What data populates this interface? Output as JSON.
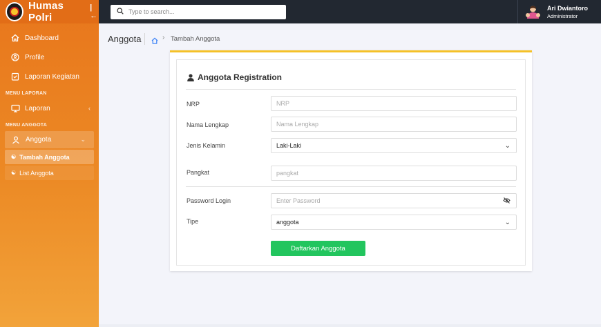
{
  "brand": {
    "name": "Humas Polri"
  },
  "sidebar": {
    "items": [
      {
        "label": "Dashboard"
      },
      {
        "label": "Profile"
      },
      {
        "label": "Laporan Kegiatan"
      }
    ],
    "sections": [
      {
        "label": "MENU LAPORAN",
        "items": [
          {
            "label": "Laporan"
          }
        ]
      },
      {
        "label": "MENU ANGGOTA",
        "items": [
          {
            "label": "Anggota"
          }
        ],
        "subitems": [
          {
            "label": "Tambah Anggota"
          },
          {
            "label": "List Anggota"
          }
        ]
      }
    ]
  },
  "topbar": {
    "search_placeholder": "Type to search...",
    "user_name": "Ari Dwiantoro",
    "user_role": "Administrator"
  },
  "breadcrumb": {
    "title": "Anggota",
    "current": "Tambah Anggota"
  },
  "form": {
    "title": "Anggota Registration",
    "fields": [
      {
        "label": "NRP",
        "placeholder": "NRP"
      },
      {
        "label": "Nama Lengkap",
        "placeholder": "Nama Lengkap"
      },
      {
        "label": "Jenis Kelamin",
        "value": "Laki-Laki"
      },
      {
        "label": "Pangkat",
        "placeholder": "pangkat"
      },
      {
        "label": "Password Login",
        "placeholder": "Enter Password"
      },
      {
        "label": "Tipe",
        "value": "anggota"
      }
    ],
    "submit_label": "Daftarkan Anggota"
  },
  "colors": {
    "sidebar": "#ec8a25",
    "topbar": "#222831",
    "accent": "#f5c127",
    "submit": "#22c55e"
  }
}
